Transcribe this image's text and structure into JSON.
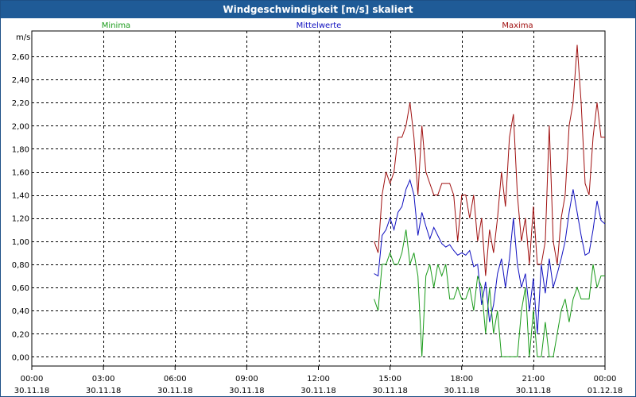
{
  "window": {
    "title": "Windgeschwindigkeit [m/s] skaliert"
  },
  "colors": {
    "minima": "#1a9b1a",
    "mittel": "#1010c0",
    "maxima": "#a01010",
    "grid": "#000000",
    "titlebar": "#1f5b97"
  },
  "chart_data": {
    "type": "line",
    "title": "Windgeschwindigkeit [m/s] skaliert",
    "ylabel": "m/s",
    "xlabel": "",
    "ylim": [
      -0.08,
      2.82
    ],
    "y_ticks": [
      0.0,
      0.2,
      0.4,
      0.6,
      0.8,
      1.0,
      1.2,
      1.4,
      1.6,
      1.8,
      2.0,
      2.2,
      2.4,
      2.6
    ],
    "y_tick_labels": [
      "0,00",
      "0,20",
      "0,40",
      "0,60",
      "0,80",
      "1,00",
      "1,20",
      "1,40",
      "1,60",
      "1,80",
      "2,00",
      "2,20",
      "2,40",
      "2,60"
    ],
    "x_ticks": [
      {
        "label1": "00:00",
        "label2": "30.11.18"
      },
      {
        "label1": "03:00",
        "label2": "30.11.18"
      },
      {
        "label1": "06:00",
        "label2": "30.11.18"
      },
      {
        "label1": "09:00",
        "label2": "30.11.18"
      },
      {
        "label1": "12:00",
        "label2": "30.11.18"
      },
      {
        "label1": "15:00",
        "label2": "30.11.18"
      },
      {
        "label1": "18:00",
        "label2": "30.11.18"
      },
      {
        "label1": "21:00",
        "label2": "30.11.18"
      },
      {
        "label1": "00:00",
        "label2": "01.12.18"
      }
    ],
    "grid": true,
    "legend": [
      "Minima",
      "Mittelwerte",
      "Maxima"
    ],
    "x": [
      "14:20",
      "14:30",
      "14:40",
      "14:50",
      "15:00",
      "15:10",
      "15:20",
      "15:30",
      "15:40",
      "15:50",
      "16:00",
      "16:10",
      "16:20",
      "16:30",
      "16:40",
      "16:50",
      "17:00",
      "17:10",
      "17:20",
      "17:30",
      "17:40",
      "17:50",
      "18:00",
      "18:10",
      "18:20",
      "18:30",
      "18:40",
      "18:50",
      "19:00",
      "19:10",
      "19:20",
      "19:30",
      "19:40",
      "19:50",
      "20:00",
      "20:10",
      "20:20",
      "20:30",
      "20:40",
      "20:50",
      "21:00",
      "21:10",
      "21:20",
      "21:30",
      "21:40",
      "21:50",
      "22:00",
      "22:10",
      "22:20",
      "22:30",
      "22:40",
      "22:50",
      "23:00",
      "23:10",
      "23:20",
      "23:30",
      "23:40",
      "23:50",
      "00:00"
    ],
    "series": [
      {
        "name": "Maxima",
        "values": [
          1.0,
          0.9,
          1.4,
          1.6,
          1.5,
          1.6,
          1.9,
          1.9,
          2.0,
          2.2,
          1.9,
          1.4,
          2.0,
          1.6,
          1.5,
          1.4,
          1.4,
          1.5,
          1.5,
          1.5,
          1.4,
          1.0,
          1.4,
          1.4,
          1.2,
          1.4,
          1.0,
          1.2,
          0.7,
          1.1,
          0.9,
          1.2,
          1.6,
          1.3,
          1.9,
          2.1,
          1.4,
          1.0,
          1.2,
          0.8,
          1.3,
          0.8,
          0.8,
          1.0,
          2.0,
          1.0,
          0.8,
          1.2,
          1.4,
          2.0,
          2.2,
          2.7,
          2.2,
          1.5,
          1.4,
          1.9,
          2.2,
          1.9,
          1.9
        ]
      },
      {
        "name": "Mittelwerte",
        "values": [
          0.72,
          0.7,
          1.05,
          1.1,
          1.2,
          1.1,
          1.25,
          1.3,
          1.45,
          1.53,
          1.4,
          1.05,
          1.25,
          1.13,
          1.02,
          1.12,
          1.05,
          0.98,
          0.95,
          0.97,
          0.92,
          0.88,
          0.9,
          0.88,
          0.92,
          0.78,
          0.8,
          0.45,
          0.65,
          0.3,
          0.45,
          0.72,
          0.85,
          0.6,
          0.85,
          1.2,
          0.8,
          0.6,
          0.72,
          0.4,
          0.68,
          0.2,
          0.8,
          0.55,
          0.85,
          0.6,
          0.72,
          0.85,
          1.0,
          1.25,
          1.45,
          1.25,
          1.05,
          0.88,
          0.9,
          1.1,
          1.35,
          1.18,
          1.15
        ]
      },
      {
        "name": "Minima",
        "values": [
          0.5,
          0.4,
          0.8,
          0.8,
          0.9,
          0.8,
          0.8,
          0.9,
          1.1,
          0.8,
          0.9,
          0.7,
          0.0,
          0.7,
          0.8,
          0.6,
          0.8,
          0.7,
          0.8,
          0.5,
          0.5,
          0.6,
          0.5,
          0.5,
          0.6,
          0.4,
          0.7,
          0.6,
          0.2,
          0.6,
          0.2,
          0.4,
          0.0,
          0.0,
          0.0,
          0.0,
          0.0,
          0.4,
          0.6,
          0.0,
          0.4,
          0.0,
          0.0,
          0.3,
          0.0,
          0.0,
          0.2,
          0.4,
          0.5,
          0.3,
          0.5,
          0.6,
          0.5,
          0.5,
          0.5,
          0.8,
          0.6,
          0.7,
          0.7
        ]
      }
    ]
  }
}
